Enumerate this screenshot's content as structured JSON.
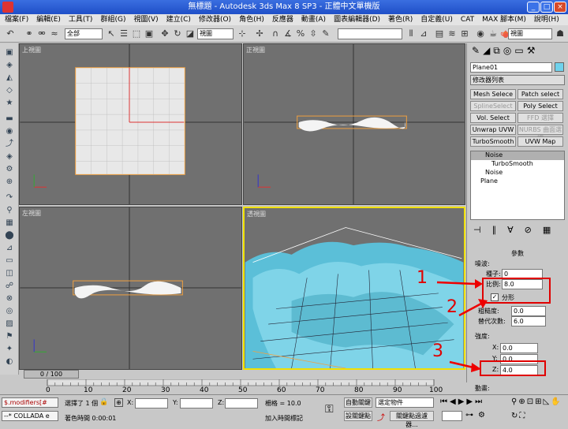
{
  "window": {
    "title": "無標題 - Autodesk 3ds Max 8 SP3 - 正體中文單機版",
    "min": "_",
    "max": "□",
    "close": "×"
  },
  "menu": [
    "檔案(F)",
    "編輯(E)",
    "工具(T)",
    "群組(G)",
    "視圖(V)",
    "建立(C)",
    "修改器(O)",
    "角色(H)",
    "反應器",
    "動畫(A)",
    "圖表編輯器(D)",
    "著色(R)",
    "自定義(U)",
    "CAT",
    "MAX 腳本(M)",
    "說明(H)"
  ],
  "toolbar": {
    "filter": "全部",
    "refcoord": "視圖",
    "named_sel": "",
    "viewport_select": "視圖"
  },
  "viewports": {
    "top": "上視圖",
    "front": "正視圖",
    "left": "左視圖",
    "persp": "透視圖"
  },
  "panel": {
    "object_name": "Plane01",
    "modlist": "修改器列表",
    "buttons": [
      "Mesh Selece",
      "Patch select",
      "SplineSelect",
      "Poly Select",
      "Vol. Select",
      "FFD 選擇",
      "Unwrap UVW",
      "NURBS 曲面選擇",
      "TurboSmooth",
      "UVW Map"
    ],
    "stack": [
      "Noise",
      "TurboSmooth",
      "Noise",
      "Plane"
    ],
    "rollout_title": "參數",
    "noise_group": "噪波:",
    "seed_label": "種子:",
    "seed": "0",
    "scale_label": "比例:",
    "scale": "8.0",
    "fractal_label": "分形",
    "roughness_label": "粗糙度:",
    "roughness": "0.0",
    "iterations_label": "替代次數:",
    "iterations": "6.0",
    "strength_group": "強度:",
    "x_label": "X:",
    "x": "0.0",
    "y_label": "Y:",
    "y": "0.0",
    "z_label": "Z:",
    "z": "4.0",
    "anim_group": "動畫:"
  },
  "annotations": [
    "1",
    "2",
    "3"
  ],
  "timeline": {
    "frame": "0 / 100",
    "ticks": [
      "0",
      "10",
      "20",
      "30",
      "40",
      "50",
      "60",
      "70",
      "80",
      "90",
      "100"
    ]
  },
  "status": {
    "script1": "$.modifiers[#",
    "script2": "--* COLLADA e",
    "selected": "選擇了 1 個",
    "prompt": "著色時間 0:00:01",
    "x_label": "X:",
    "y_label": "Y:",
    "z_label": "Z:",
    "grid": "柵格 = 10.0",
    "add_time_tag": "加入時間標記",
    "auto_key": "自動關鍵",
    "set_key": "設關鍵點",
    "sel_obj": "選定物件",
    "key_filters": "關鍵點過濾器..."
  }
}
